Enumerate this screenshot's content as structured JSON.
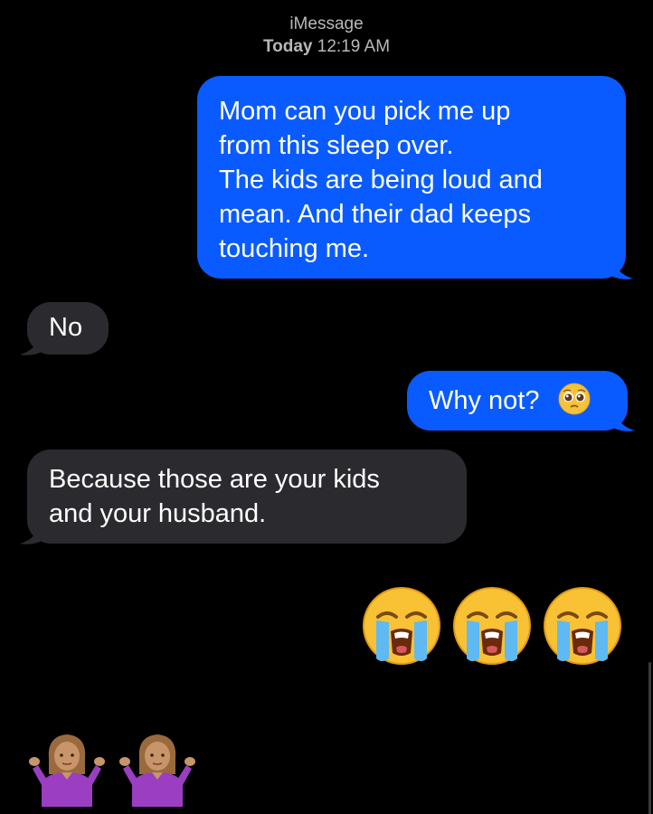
{
  "header": {
    "service": "iMessage",
    "day": "Today",
    "time": "12:19 AM"
  },
  "messages": [
    {
      "direction": "outgoing",
      "lines": [
        "Mom can you pick me up",
        "from this sleep over.",
        "The kids are being loud and",
        "mean. And their dad keeps",
        "touching me."
      ]
    },
    {
      "direction": "incoming",
      "lines": [
        "No"
      ]
    },
    {
      "direction": "outgoing",
      "lines": [
        "Why not?"
      ],
      "emoji": "pleading-face-emoji"
    },
    {
      "direction": "incoming",
      "lines": [
        "Because those are your kids",
        "and your husband."
      ]
    }
  ],
  "reactions": {
    "outgoing_emojis": [
      "loudly-crying-face-emoji",
      "loudly-crying-face-emoji",
      "loudly-crying-face-emoji"
    ],
    "incoming_emojis": [
      "woman-shrugging-emoji",
      "woman-shrugging-emoji"
    ]
  },
  "colors": {
    "outgoing_bubble": "#0a5bff",
    "incoming_bubble": "#2b2b2f",
    "background": "#000000",
    "header_text": "#b8b8bc"
  }
}
